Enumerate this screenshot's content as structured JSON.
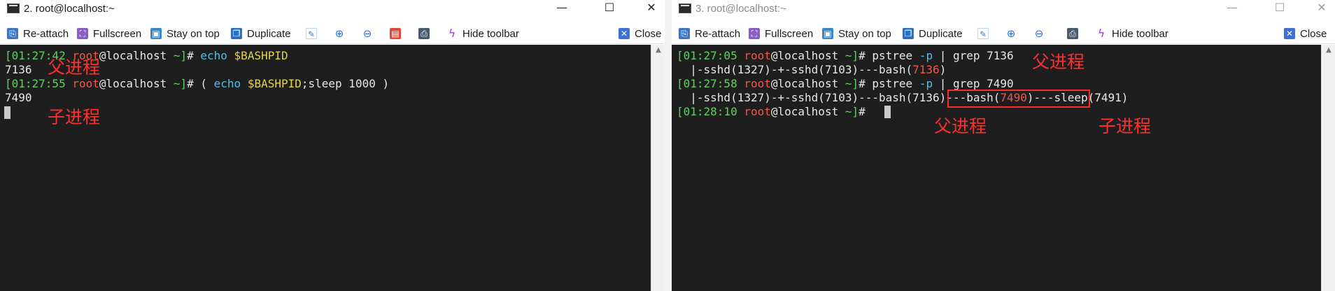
{
  "left_window": {
    "title": "2. root@localhost:~",
    "window_controls": {
      "minimize": "—",
      "maximize": "☐",
      "close": "✕"
    },
    "toolbar": {
      "reattach": "Re-attach",
      "fullscreen": "Fullscreen",
      "stay_on_top": "Stay on top",
      "duplicate": "Duplicate",
      "hide_toolbar": "Hide toolbar",
      "close": "Close"
    },
    "terminal": {
      "line1": {
        "time": "[01:27:42",
        "user": "root",
        "host": "@localhost",
        "path": " ~]",
        "hash": "# ",
        "cmd": "echo",
        "var": "$BASHPID"
      },
      "line2": "7136",
      "line3": {
        "time": "[01:27:55",
        "user": "root",
        "host": "@localhost",
        "path": " ~]",
        "hash": "# ( ",
        "cmd": "echo",
        "sp": " ",
        "var": "$BASHPID",
        "rest": ";sleep 1000 )"
      },
      "line4": "7490"
    },
    "annotations": {
      "parent": "父进程",
      "child": "子进程"
    }
  },
  "right_window": {
    "title": "3. root@localhost:~",
    "window_controls": {
      "minimize": "—",
      "maximize": "☐",
      "close": "✕"
    },
    "toolbar": {
      "reattach": "Re-attach",
      "fullscreen": "Fullscreen",
      "stay_on_top": "Stay on top",
      "duplicate": "Duplicate",
      "hide_toolbar": "Hide toolbar",
      "close": "Close"
    },
    "terminal": {
      "line1": {
        "time": "[01:27:05",
        "user": "root",
        "host": "@localhost",
        "path": " ~]",
        "hash": "# pstree ",
        "flag": "-p",
        "rest": " | grep 7136"
      },
      "line2": {
        "pre": "  |-sshd(1327)-+-sshd(7103)---bash(",
        "pid": "7136",
        "post": ")"
      },
      "line3": {
        "time": "[01:27:58",
        "user": "root",
        "host": "@localhost",
        "path": " ~]",
        "hash": "# pstree ",
        "flag": "-p",
        "rest": " | grep 7490"
      },
      "line4": {
        "pre": "  |-sshd(1327)-+-sshd(7103)---bash(7136)---bash(",
        "pid": "7490",
        "post": ")---sleep(7491)"
      },
      "line5": {
        "time": "[01:28:10",
        "user": "root",
        "host": "@localhost",
        "path": " ~]",
        "hash": "# "
      }
    },
    "annotations": {
      "parent_top": "父进程",
      "parent_bottom": "父进程",
      "child_bottom": "子进程"
    }
  },
  "colors": {
    "terminal_bg": "#1e1e1e",
    "prompt_time": "#5fd35f",
    "prompt_user": "#ea5a4e",
    "command": "#4fc1e9",
    "variable": "#e5d34a",
    "annotation": "#ff2f2f"
  },
  "icons": [
    "terminal-app-icon",
    "reattach-icon",
    "fullscreen-icon",
    "stay-on-top-icon",
    "duplicate-icon",
    "edit-icon",
    "zoom-in-icon",
    "zoom-out-icon",
    "save-icon",
    "print-icon",
    "bolt-icon",
    "close-icon"
  ]
}
